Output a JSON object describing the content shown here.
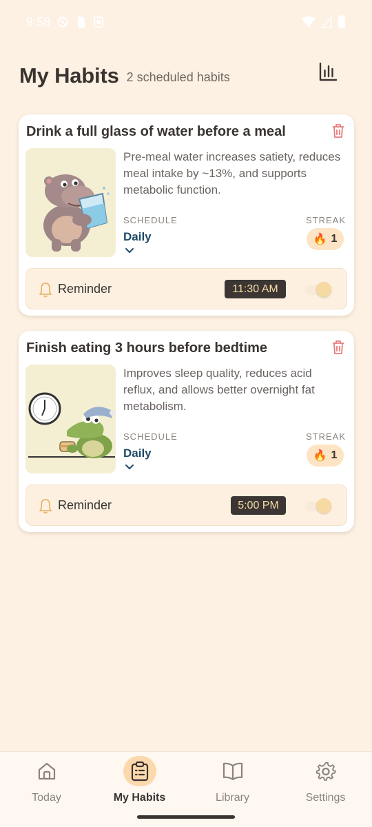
{
  "status_bar": {
    "time": "9:58",
    "icons_left": [
      "do-not-disturb-icon",
      "sim-card-icon",
      "notification-icon"
    ],
    "icons_right": [
      "wifi-icon",
      "signal-icon",
      "battery-icon"
    ]
  },
  "header": {
    "title": "My Habits",
    "subtitle": "2 scheduled habits",
    "stats_icon": "bar-chart-icon"
  },
  "habits": [
    {
      "title": "Drink a full glass of water before a meal",
      "illustration": "hippo-drinking-water",
      "description": "Pre-meal water increases satiety, reduces meal intake by ~13%, and supports metabolic function.",
      "schedule_label": "SCHEDULE",
      "schedule_value": "Daily",
      "streak_label": "STREAK",
      "streak_icon": "🔥",
      "streak_value": "1",
      "reminder_label": "Reminder",
      "reminder_time": "11:30 AM",
      "reminder_enabled": true
    },
    {
      "title": "Finish eating 3 hours before bedtime",
      "illustration": "crocodile-eating-sandwich-clock",
      "description": "Improves sleep quality, reduces acid reflux, and allows better overnight fat metabolism.",
      "schedule_label": "SCHEDULE",
      "schedule_value": "Daily",
      "streak_label": "STREAK",
      "streak_icon": "🔥",
      "streak_value": "1",
      "reminder_label": "Reminder",
      "reminder_time": "5:00 PM",
      "reminder_enabled": true
    }
  ],
  "bottom_nav": {
    "items": [
      {
        "label": "Today",
        "icon": "home-icon",
        "active": false
      },
      {
        "label": "My Habits",
        "icon": "clipboard-icon",
        "active": true
      },
      {
        "label": "Library",
        "icon": "book-icon",
        "active": false
      },
      {
        "label": "Settings",
        "icon": "gear-icon",
        "active": false
      }
    ]
  },
  "colors": {
    "background": "#FDF1E3",
    "accent": "#FCD9AD",
    "schedule_text": "#1f4a66",
    "delete_icon": "#E87B7B",
    "time_chip_bg": "#3b3633",
    "time_chip_text": "#f6d9a8"
  }
}
